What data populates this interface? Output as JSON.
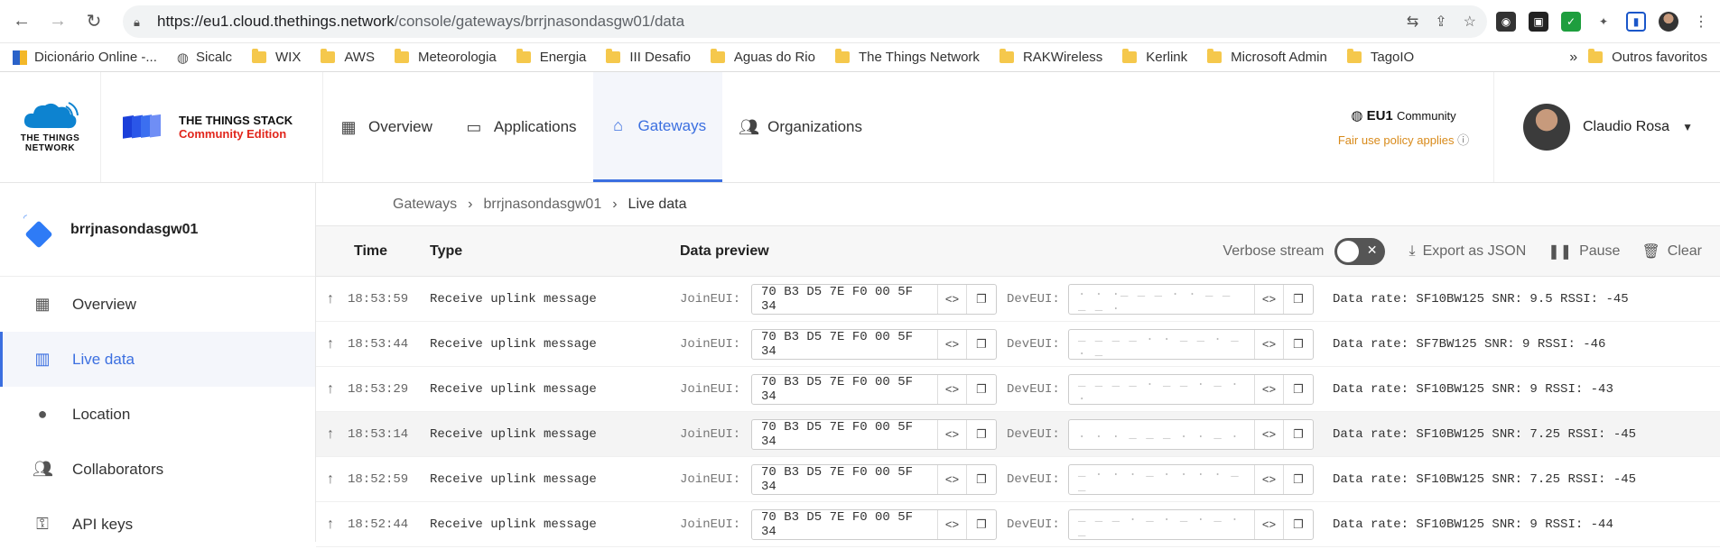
{
  "browser": {
    "url_host": "https://eu1.cloud.thethings.network",
    "url_path": "/console/gateways/brrjnasondasgw01/data"
  },
  "bookmarks": [
    {
      "label": "Dicionário Online -..."
    },
    {
      "label": "Sicalc"
    },
    {
      "label": "WIX"
    },
    {
      "label": "AWS"
    },
    {
      "label": "Meteorologia"
    },
    {
      "label": "Energia"
    },
    {
      "label": "III Desafio"
    },
    {
      "label": "Aguas do Rio"
    },
    {
      "label": "The Things Network"
    },
    {
      "label": "RAKWireless"
    },
    {
      "label": "Kerlink"
    },
    {
      "label": "Microsoft Admin"
    },
    {
      "label": "TagoIO"
    }
  ],
  "bookmarks_more": "»",
  "bookmarks_other": "Outros favoritos",
  "header": {
    "ttn_logo_line1": "THE THINGS",
    "ttn_logo_line2": "NETWORK",
    "stack_line1": "THE THINGS STACK",
    "stack_line2": "Community Edition",
    "nav": [
      {
        "label": "Overview"
      },
      {
        "label": "Applications"
      },
      {
        "label": "Gateways"
      },
      {
        "label": "Organizations"
      }
    ],
    "cluster_region": "EU1",
    "cluster_type": "Community",
    "fair_use": "Fair use policy applies",
    "user_name": "Claudio Rosa"
  },
  "sidebar": {
    "gateway_name": "brrjnasondasgw01",
    "items": [
      {
        "label": "Overview"
      },
      {
        "label": "Live data"
      },
      {
        "label": "Location"
      },
      {
        "label": "Collaborators"
      },
      {
        "label": "API keys"
      }
    ]
  },
  "breadcrumb": {
    "b1": "Gateways",
    "b2": "brrjnasondasgw01",
    "b3": "Live data"
  },
  "table": {
    "col_time": "Time",
    "col_type": "Type",
    "col_data": "Data preview",
    "verbose": "Verbose stream",
    "export": "Export as JSON",
    "pause": "Pause",
    "clear": "Clear",
    "rows": [
      {
        "time": "18:53:59",
        "type": "Receive uplink message",
        "join_label": "JoinEUI:",
        "join": "70 B3 D5 7E F0 00 5F 34",
        "dev_label": "DevEUI:",
        "dev": ". . ._ _ _ . . _ _ _ _ .",
        "meta": "Data rate: SF10BW125  SNR: 9.5  RSSI: -45"
      },
      {
        "time": "18:53:44",
        "type": "Receive uplink message",
        "join_label": "JoinEUI:",
        "join": "70 B3 D5 7E F0 00 5F 34",
        "dev_label": "DevEUI:",
        "dev": "_ _ _ _ . . _ _ . _ . _",
        "meta": "Data rate: SF7BW125  SNR: 9  RSSI: -46"
      },
      {
        "time": "18:53:29",
        "type": "Receive uplink message",
        "join_label": "JoinEUI:",
        "join": "70 B3 D5 7E F0 00 5F 34",
        "dev_label": "DevEUI:",
        "dev": "_ _ _ _ . _ _ . _ . .",
        "meta": "Data rate: SF10BW125  SNR: 9  RSSI: -43"
      },
      {
        "time": "18:53:14",
        "type": "Receive uplink message",
        "join_label": "JoinEUI:",
        "join": "70 B3 D5 7E F0 00 5F 34",
        "dev_label": "DevEUI:",
        "dev": ". . . _ _ _ . . _ .",
        "meta": "Data rate: SF10BW125  SNR: 7.25  RSSI: -45"
      },
      {
        "time": "18:52:59",
        "type": "Receive uplink message",
        "join_label": "JoinEUI:",
        "join": "70 B3 D5 7E F0 00 5F 34",
        "dev_label": "DevEUI:",
        "dev": "_ . . . _ . . . . _ _",
        "meta": "Data rate: SF10BW125  SNR: 7.25  RSSI: -45"
      },
      {
        "time": "18:52:44",
        "type": "Receive uplink message",
        "join_label": "JoinEUI:",
        "join": "70 B3 D5 7E F0 00 5F 34",
        "dev_label": "DevEUI:",
        "dev": "_ _ _ . _ . _ . _ . _",
        "meta": "Data rate: SF10BW125  SNR: 9  RSSI: -44"
      }
    ]
  }
}
